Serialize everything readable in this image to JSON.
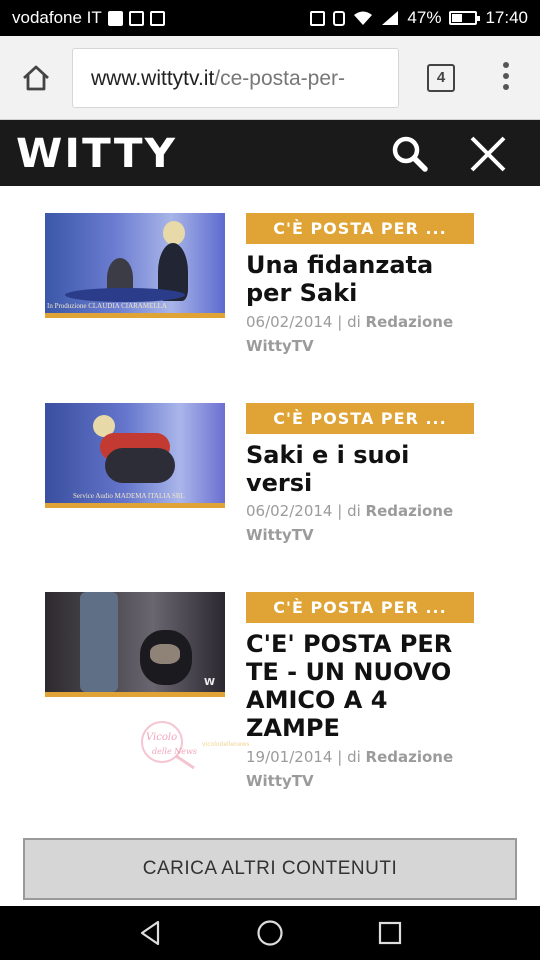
{
  "status_bar": {
    "carrier": "vodafone IT",
    "battery_percent": "47%",
    "battery_level": 0.47,
    "time": "17:40",
    "icons": [
      "facebook-icon",
      "instagram-icon",
      "gallery-icon",
      "nfc-icon",
      "vibrate-icon",
      "wifi-icon",
      "signal-icon",
      "battery-icon"
    ]
  },
  "browser": {
    "url_host": "www.wittytv.it",
    "url_path": "/ce-posta-per-",
    "tab_count": "4",
    "icons": [
      "home-icon",
      "tabs-icon",
      "more-vert-icon"
    ]
  },
  "site_header": {
    "logo_text": "WITTY",
    "icons": [
      "search-icon",
      "close-icon"
    ],
    "background_color": "#1a1a1a"
  },
  "articles": [
    {
      "tag": "C'È POSTA PER ...",
      "title": "Una fidanzata per Saki",
      "date": "06/02/2014",
      "by_label": "| di",
      "author": "Redazione WittyTV",
      "thumb_caption": "In Produzione CLAUDIA CIARAMELLA"
    },
    {
      "tag": "C'È POSTA PER ...",
      "title": "Saki e i suoi versi",
      "date": "06/02/2014",
      "by_label": "| di",
      "author": "Redazione WittyTV",
      "thumb_caption": "Service Audio MADEMA ITALIA SRL"
    },
    {
      "tag": "C'È POSTA PER ...",
      "title": "C'E' POSTA PER TE - UN NUOVO AMICO A 4 ZAMPE",
      "date": "19/01/2014",
      "by_label": "| di",
      "author": "Redazione WittyTV",
      "thumb_caption": "W"
    }
  ],
  "watermark": {
    "text": "Vicolo delle News"
  },
  "load_more": {
    "label": "CARICA ALTRI CONTENUTI"
  },
  "nav_bar": {
    "icons": [
      "back-icon",
      "home-circle-icon",
      "recents-icon"
    ]
  },
  "colors": {
    "accent": "#e0a436",
    "header": "#1a1a1a",
    "title_text": "#111111",
    "meta_text": "#9b9b9b"
  }
}
